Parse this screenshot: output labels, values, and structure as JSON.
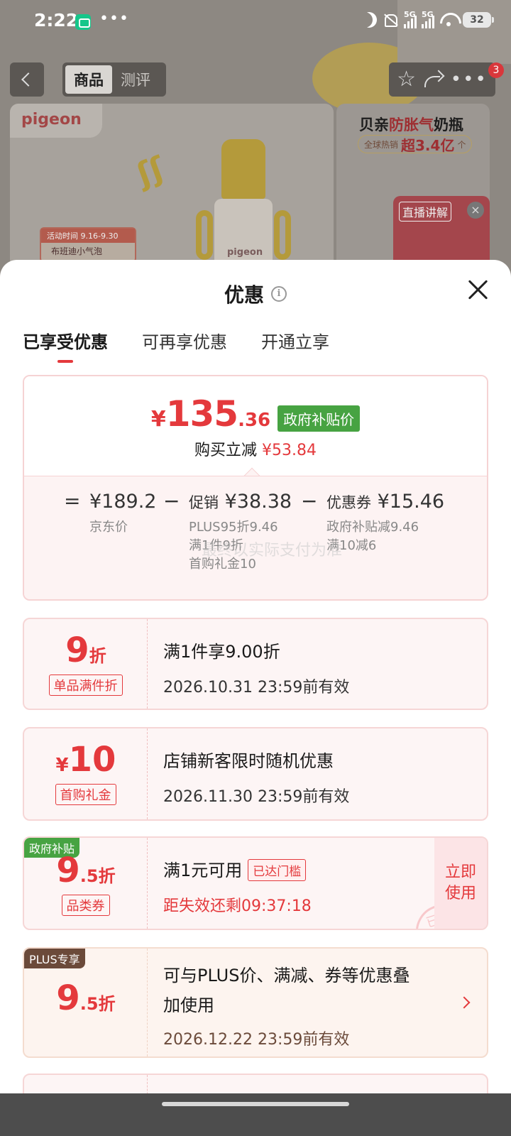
{
  "status_bar": {
    "time": "2:22",
    "dots": "•••",
    "battery": "32",
    "net1": "5G",
    "net2": "5G"
  },
  "nav": {
    "tab_goods": "商品",
    "tab_review": "测评",
    "badge_count": "3"
  },
  "background": {
    "brand": "pigeon",
    "bottle_label": "pigeon",
    "promo_tag_time": "活动时间 9.16-9.30",
    "promo_tag_text": "布班迪小气泡",
    "side_ad_title_prefix": "贝亲",
    "side_ad_title_em": "防胀气",
    "side_ad_title_suffix": "奶瓶",
    "side_ad_sub_prefix": "全球热销",
    "side_ad_sub_big": "超3.4亿",
    "side_ad_sub_suffix": "个",
    "live_label": "直播讲解"
  },
  "sheet": {
    "title": "优惠",
    "tabs": [
      "已享受优惠",
      "可再享优惠",
      "开通立享"
    ]
  },
  "summary": {
    "price_symbol": "¥",
    "price_int": "135",
    "price_dec": ".36",
    "gov_tag": "政府补贴价",
    "saving_label": "购买立减",
    "saving_amount": "¥53.84",
    "eq": "=",
    "minus": "−",
    "jd_price": "¥189.2",
    "jd_label": "京东价",
    "promo_label": "促销",
    "promo_amount": "¥38.38",
    "promo_lines": [
      "PLUS95折9.46",
      "满1件9折",
      "首购礼金10"
    ],
    "coupon_label": "优惠券",
    "coupon_amount": "¥15.46",
    "coupon_lines": [
      "政府补贴减9.46",
      "满10减6"
    ],
    "watermark": "最终以实际支付为准"
  },
  "coupons": [
    {
      "value_big": "9",
      "value_sm": "折",
      "tag": "单品满件折",
      "title": "满1件享9.00折",
      "sub": "2026.10.31 23:59前有效"
    },
    {
      "value_yen": "¥",
      "value_big": "10",
      "tag": "首购礼金",
      "title": "店铺新客限时随机优惠",
      "sub": "2026.11.30 23:59前有效"
    },
    {
      "corner": "政府补贴",
      "value_big": "9",
      "value_sm": ".5折",
      "tag": "品类券",
      "title": "满1元可用",
      "reach_tag": "已达门槛",
      "sub": "距失效还剩09:37:18",
      "use_label_1": "立即",
      "use_label_2": "使用",
      "stamp": "已领"
    },
    {
      "corner": "PLUS专享",
      "value_big": "9",
      "value_sm": ".5折",
      "title_1": "可与PLUS价、满减、券等优惠叠",
      "title_2": "加使用",
      "sub": "2026.12.22 23:59前有效"
    }
  ],
  "colors": {
    "accent_red": "#e4393c",
    "gov_green": "#47a342",
    "plus_brown": "#6b4a3a"
  }
}
